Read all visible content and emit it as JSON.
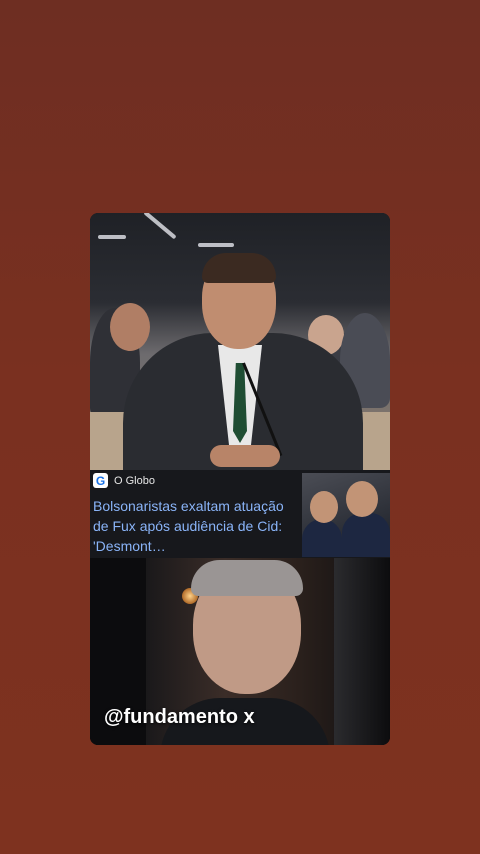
{
  "news": {
    "source_icon": "google-news-icon",
    "source_letter": "G",
    "source": "O Globo",
    "headline": "Bolsonaristas exaltam atuação de Fux após audiência de Cid: 'Desmont…"
  },
  "overlay": {
    "watermark": "@fundamento x"
  },
  "colors": {
    "background": "#7a3020",
    "headline": "#8ab4f8"
  }
}
